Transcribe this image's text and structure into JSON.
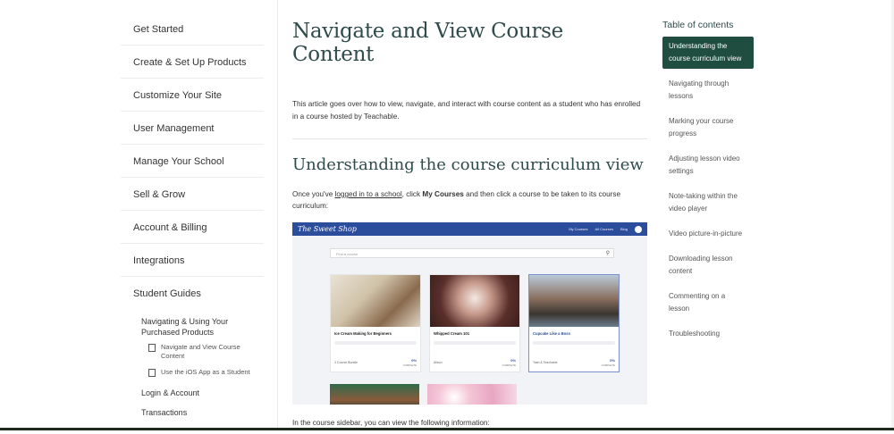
{
  "left_nav": {
    "items": [
      {
        "label": "Get Started"
      },
      {
        "label": "Create & Set Up Products"
      },
      {
        "label": "Customize Your Site"
      },
      {
        "label": "User Management"
      },
      {
        "label": "Manage Your School"
      },
      {
        "label": "Sell & Grow"
      },
      {
        "label": "Account & Billing"
      },
      {
        "label": "Integrations"
      },
      {
        "label": "Student Guides"
      }
    ],
    "sub_group": "Navigating & Using Your Purchased Products",
    "sub_links": [
      {
        "label": "Navigate and View Course Content"
      },
      {
        "label": "Use the iOS App as a Student"
      }
    ],
    "login_account": "Login & Account",
    "transactions": "Transactions"
  },
  "main": {
    "title": "Navigate and View Course Content",
    "intro": "This article goes over how to view, navigate, and interact with course content as a student who has enrolled in a course hosted by Teachable.",
    "section_title": "Understanding the course curriculum view",
    "para_prefix": "Once you've ",
    "para_link": "logged in to a school",
    "para_mid": ", click ",
    "para_bold": "My Courses",
    "para_suffix": " and then click a course to be taken to its course curriculum:",
    "after_text": "In the course sidebar, you can view the following information:"
  },
  "screenshot": {
    "brand": "The Sweet Shop",
    "menu": [
      "My Courses",
      "All Courses",
      "Blog"
    ],
    "search_placeholder": "Find a course",
    "cards": [
      {
        "title": "Ice Cream Making for Beginners",
        "author": "3 Course Bundle",
        "pct": "0%",
        "pct_label": "COMPLETE"
      },
      {
        "title": "Whipped Cream 101",
        "author": "Alison",
        "pct": "0%",
        "pct_label": "COMPLETE"
      },
      {
        "title": "Cupcake Like a Boss",
        "author": "Tash & Teachable",
        "pct": "0%",
        "pct_label": "COMPLETE"
      }
    ]
  },
  "toc": {
    "title": "Table of contents",
    "items": [
      {
        "label": "Understanding the course curriculum view"
      },
      {
        "label": "Navigating through lessons"
      },
      {
        "label": "Marking your course progress"
      },
      {
        "label": "Adjusting lesson video settings"
      },
      {
        "label": "Note-taking within the video player"
      },
      {
        "label": "Video picture-in-picture"
      },
      {
        "label": "Downloading lesson content"
      },
      {
        "label": "Commenting on a lesson"
      },
      {
        "label": "Troubleshooting"
      }
    ]
  },
  "colors": {
    "heading": "#2f4b4b",
    "toc_active_bg": "#1f4d3f",
    "screenshot_bar": "#2b4d9c"
  }
}
